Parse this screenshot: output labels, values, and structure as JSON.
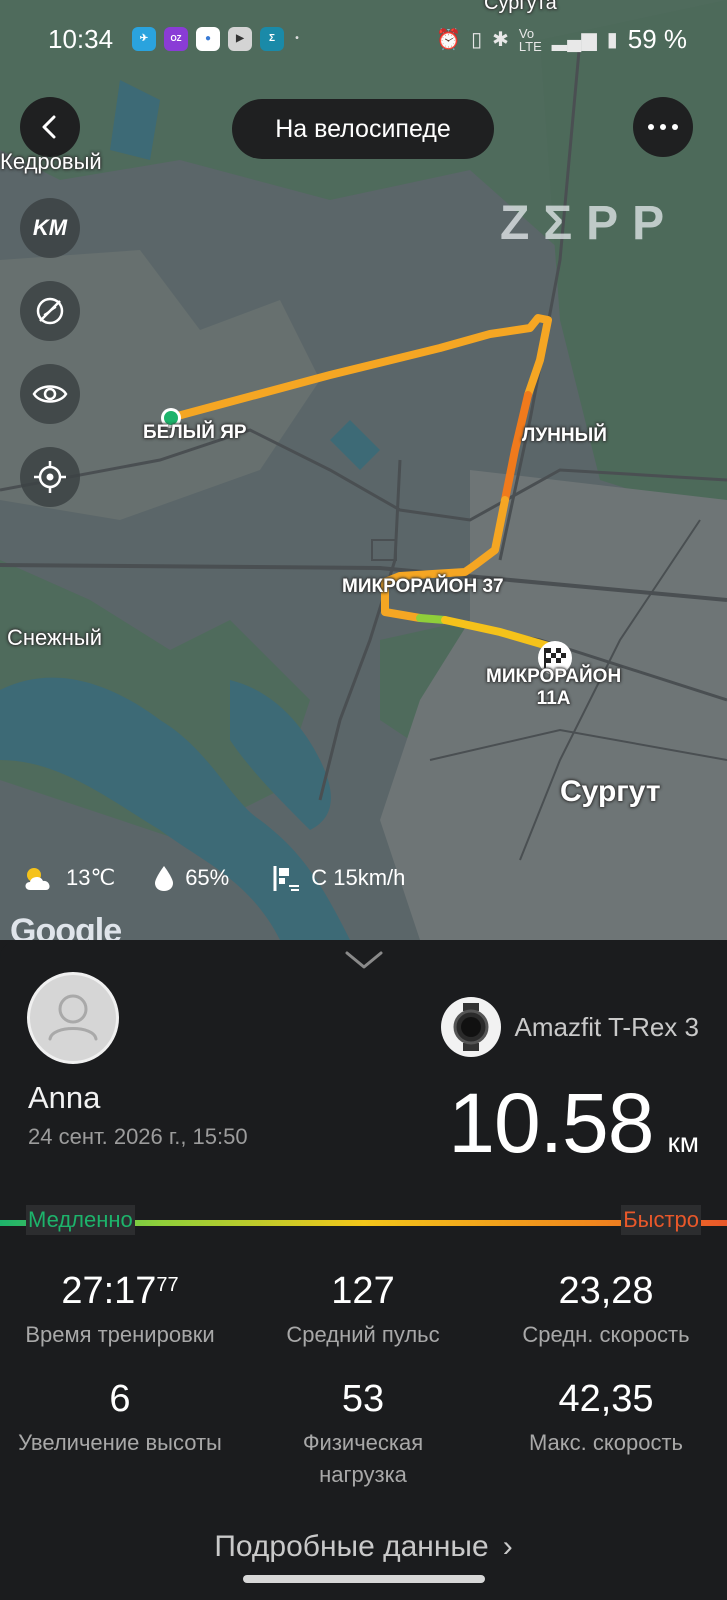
{
  "status_bar": {
    "time": "10:34",
    "battery": "59 %"
  },
  "map": {
    "activity_title": "На велосипеде",
    "watermark": "ZΣPP",
    "places": {
      "kedrovy": "Кедровый",
      "bely_yar": "БЕЛЫЙ ЯР",
      "lunny": "ЛУННЫЙ",
      "mkr37": "МИКРОРАЙОН 37",
      "snezhny": "Снежный",
      "mkr11a_line1": "МИКРОРАЙОН",
      "mkr11a_line2": "11А",
      "surgut": "Сургут",
      "surguta_top": "Сургута"
    },
    "weather": {
      "temperature": "13℃",
      "humidity": "65%",
      "wind": "С 15km/h"
    },
    "attribution": "Google"
  },
  "workout": {
    "user_name": "Anna",
    "date": "24 сент. 2026 г., 15:50",
    "device_name": "Amazfit T-Rex 3",
    "distance_value": "10.58",
    "distance_unit": "км",
    "speed_legend": {
      "slow": "Медленно",
      "fast": "Быстро"
    },
    "stats": [
      {
        "value": "27:17",
        "superscript": "77",
        "label": "Время тренировки"
      },
      {
        "value": "127",
        "label": "Средний пульс"
      },
      {
        "value": "23,28",
        "label": "Средн. скорость"
      },
      {
        "value": "6",
        "label": "Увеличение высоты"
      },
      {
        "value": "53",
        "label": "Физическая нагрузка",
        "label_line1": "Физическая",
        "label_line2": "нагрузка"
      },
      {
        "value": "42,35",
        "label": "Макс. скорость"
      }
    ],
    "details_link": "Подробные данные"
  }
}
